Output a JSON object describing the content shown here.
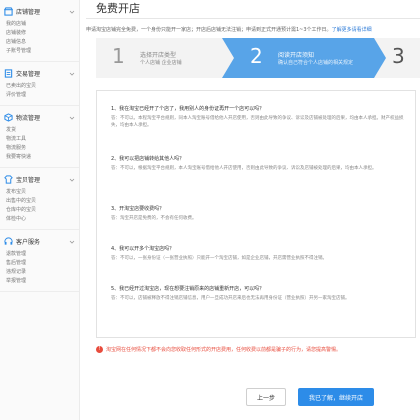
{
  "sidebar": {
    "groups": [
      {
        "title": "店铺管理",
        "icon": "shop-icon",
        "color": "#2d8ce8",
        "links": [
          "我的店铺",
          "店铺装修",
          "店铺信息",
          "子账号管理"
        ]
      },
      {
        "title": "交易管理",
        "icon": "trade-icon",
        "color": "#2d8ce8",
        "links": [
          "已卖出的宝贝",
          "评价管理"
        ]
      },
      {
        "title": "物流管理",
        "icon": "logistics-icon",
        "color": "#2d8ce8",
        "links": [
          "发货",
          "物流工具",
          "物流服务",
          "我要寄快递"
        ]
      },
      {
        "title": "宝贝管理",
        "icon": "goods-icon",
        "color": "#2d8ce8",
        "links": [
          "发布宝贝",
          "出售中的宝贝",
          "仓库中的宝贝",
          "体检中心"
        ]
      },
      {
        "title": "客户服务",
        "icon": "service-icon",
        "color": "#2d8ce8",
        "links": [
          "退款管理",
          "售后管理",
          "违规记录",
          "举报管理"
        ]
      }
    ]
  },
  "page": {
    "title": "免费开店",
    "notice": "申请淘宝店铺完全免费，一个身份只能开一家店；开店后店铺无法注销；申请到正式开通预计需1~3个工作日。",
    "notice_link": "了解更多请看详细"
  },
  "steps": [
    {
      "num": "1",
      "title": "选择开店类型",
      "sub": "个人店铺 企业店铺"
    },
    {
      "num": "2",
      "title": "阅读开店须知",
      "sub": "确认自己符合个人店铺的相关规定"
    },
    {
      "num": "3",
      "title": "",
      "sub": ""
    }
  ],
  "faq": [
    {
      "q": "1、我在淘宝已经开了个店了，我用别人的身份证再开一个店可以吗？",
      "a": "答：不可以。本程淘宝平台规则，同本人淘宝账号借给他人开店使用，否则由此导致的争议、诉讼及店铺被处理的后果，均由本人承担。财产权益损失，均由本人承担。"
    },
    {
      "q": "2、我可以把店铺转给其他人吗？",
      "a": "答：不可以，根据淘宝平台规则，本人淘宝账号借给他人开店使用，否则由此导致的争议、诉讼及店铺被处理的后果，均由本人承担。"
    },
    {
      "q": "3、开淘宝店要收费吗？",
      "a": "答：淘宝开店是免费的，不会有任何收费。"
    },
    {
      "q": "4、我可以开多个淘宝店吗？",
      "a": "答：不可以，一张身份证（一张营业执照）只能开一个淘宝店铺，如是企业店铺，开店需营业执照不得注销。"
    },
    {
      "q": "5、我已经开过淘宝店，现在想要注销原来的店铺重新开店，可以吗？",
      "a": "答：不可以，店铺被释放不得注销店铺信息，用户一旦成功开店来后也无法再用身份证（营业执照）开另一家淘宝店铺。"
    }
  ],
  "warning": "淘宝网在任何情况下都不会向您收取任何形式的开店费用，任何收费以前都是骗子的行为，请您提高警惕。",
  "buttons": {
    "prev": "上一步",
    "next": "我已了解，继续开店"
  }
}
